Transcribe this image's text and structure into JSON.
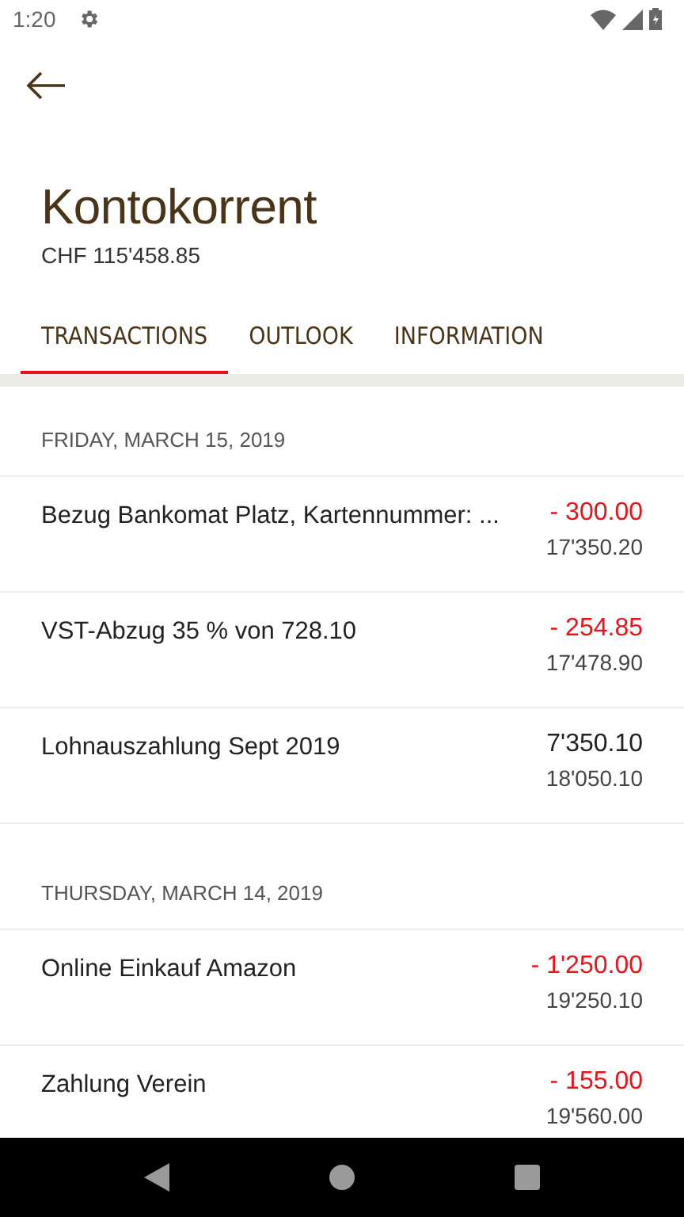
{
  "status_bar": {
    "time": "1:20"
  },
  "account": {
    "title": "Kontokorrent",
    "balance": "CHF 115'458.85"
  },
  "tabs": [
    {
      "label": "TRANSACTIONS",
      "selected": true
    },
    {
      "label": "OUTLOOK",
      "selected": false
    },
    {
      "label": "INFORMATION",
      "selected": false
    }
  ],
  "groups": [
    {
      "date": "FRIDAY, MARCH 15, 2019",
      "transactions": [
        {
          "description": "Bezug Bankomat Platz, Kartennummer: ...",
          "amount": "- 300.00",
          "kind": "debit",
          "balance": "17'350.20"
        },
        {
          "description": "VST-Abzug 35 % von 728.10",
          "amount": "- 254.85",
          "kind": "debit",
          "balance": "17'478.90"
        },
        {
          "description": "Lohnauszahlung Sept 2019",
          "amount": "7'350.10",
          "kind": "credit",
          "balance": "18'050.10"
        }
      ]
    },
    {
      "date": "THURSDAY, MARCH 14, 2019",
      "transactions": [
        {
          "description": "Online Einkauf Amazon",
          "amount": "- 1'250.00",
          "kind": "debit",
          "balance": "19'250.10"
        },
        {
          "description": "Zahlung Verein",
          "amount": "- 155.00",
          "kind": "debit",
          "balance": "19'560.00"
        }
      ]
    }
  ]
}
